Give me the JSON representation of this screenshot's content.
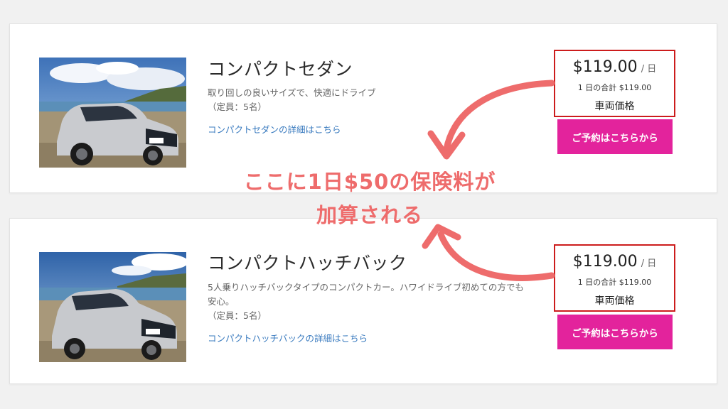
{
  "listings": [
    {
      "title": "コンパクトセダン",
      "description_lines": [
        "取り回しの良いサイズで、快適にドライブ",
        "（定員：5名）"
      ],
      "detail_link": "コンパクトセダンの詳細はこちら",
      "price": "$119.00",
      "price_unit": "/ 日",
      "daily_total": "1 日の合計 $119.00",
      "price_caption": "車両価格",
      "reserve_button": "ご予約はこちらから"
    },
    {
      "title": "コンパクトハッチバック",
      "description_lines": [
        "5人乗りハッチバックタイプのコンパクトカー。ハワイドライブ初めての方でも安心。",
        "（定員：5名）"
      ],
      "detail_link": "コンパクトハッチバックの詳細はこちら",
      "price": "$119.00",
      "price_unit": "/ 日",
      "daily_total": "1 日の合計 $119.00",
      "price_caption": "車両価格",
      "reserve_button": "ご予約はこちらから"
    }
  ],
  "annotation": {
    "line1": "ここに1日$50の保険料が",
    "line2": "加算される"
  },
  "colors": {
    "price_border": "#cc1c1c",
    "reserve_button": "#e3239c",
    "link": "#3a7bbf",
    "annotation": "#ee6c6c"
  },
  "icons": [
    "sedan-car-photo",
    "hatchback-car-photo",
    "curved-arrow-icon"
  ]
}
